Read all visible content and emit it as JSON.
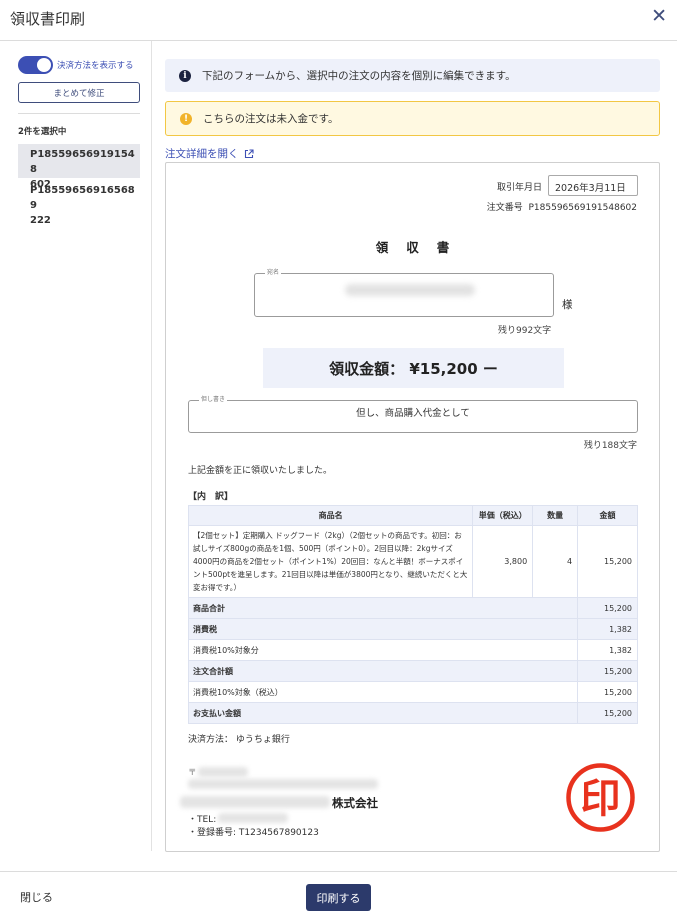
{
  "header": {
    "title": "領収書印刷",
    "close_label": "✕"
  },
  "sidebar": {
    "toggle_label": "決済方法を表示する",
    "bulk_edit_label": "まとめて修正",
    "selected_count": "2件を選択中",
    "orders": [
      {
        "line1": "P185596569191548",
        "line2": "602",
        "active": true
      },
      {
        "line1": "P185596569165689",
        "line2": "222",
        "active": false
      }
    ]
  },
  "notices": {
    "info": "下記のフォームから、選択中の注文の内容を個別に編集できます。",
    "warning": "こちらの注文は未入金です。",
    "detail_link": "注文詳細を開く"
  },
  "receipt": {
    "date_label": "取引年月日",
    "date_value": "2026年3月11日",
    "order_no_label": "注文番号",
    "order_no": "P185596569191548602",
    "title": "領収書",
    "addressee_legend": "宛名",
    "honorific": "様",
    "addressee_remaining": "残り992文字",
    "amount": "領収金額： ¥15,200 ー",
    "note_legend": "但し書き",
    "note_value": "但し、商品購入代金として",
    "note_remaining": "残り188文字",
    "received_text": "上記金額を正に領収いたしました。",
    "breakdown_label": "【内　訳】",
    "table": {
      "headers": [
        "商品名",
        "単価（税込）",
        "数量",
        "金額"
      ],
      "item": {
        "name": "【2個セット】定期購入 ドッグフード（2kg）（2個セットの商品です。初回：お試しサイズ800gの商品を1個、500円（ポイント0）。2回目以降：2kgサイズ4000円の商品を2個セット（ポイント1%）20回目：なんと半額！ボーナスポイント500ptを進呈します。21回目以降は単価が3800円となり、継続いただくと大変お得です。）",
        "price": "3,800",
        "qty": "4",
        "amount": "15,200"
      },
      "summary": [
        {
          "label": "商品合計",
          "value": "15,200",
          "shaded": true
        },
        {
          "label": "消費税",
          "value": "1,382",
          "shaded": true
        },
        {
          "label": "消費税10%対象分",
          "value": "1,382",
          "shaded": false
        },
        {
          "label": "注文合計額",
          "value": "15,200",
          "shaded": true
        },
        {
          "label": "消費税10%対象（税込）",
          "value": "15,200",
          "shaded": false
        },
        {
          "label": "お支払い金額",
          "value": "15,200",
          "shaded": true
        }
      ]
    },
    "payment_method": "決済方法： ゆうちょ銀行",
    "postal_mark": "〒",
    "company_suffix": "株式会社",
    "tel_label": "・TEL:",
    "registration": "・登録番号: T1234567890123",
    "stamp_char": "印"
  },
  "footer": {
    "close_label": "閉じる",
    "print_label": "印刷する"
  },
  "colors": {
    "accent": "#3c4fb4",
    "primary_button": "#2c3a6b",
    "stamp": "#e8321e",
    "warning_border": "#f2c744"
  }
}
